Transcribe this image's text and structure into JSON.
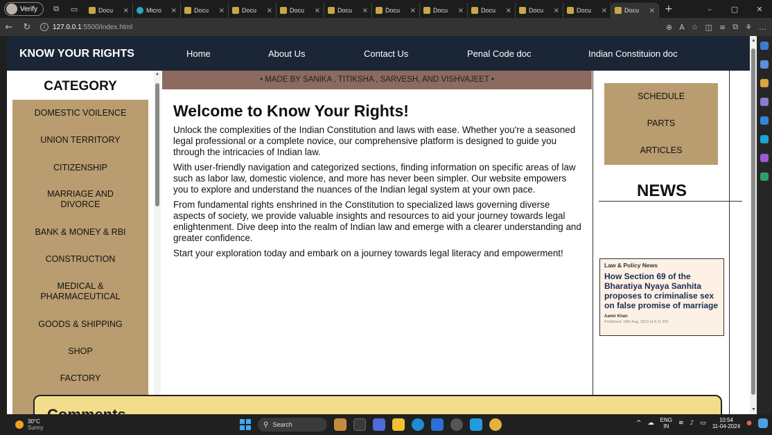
{
  "browser": {
    "profile_label": "Verify",
    "tabs": [
      {
        "label": "Docu"
      },
      {
        "label": "Micro"
      },
      {
        "label": "Docu"
      },
      {
        "label": "Docu"
      },
      {
        "label": "Docu"
      },
      {
        "label": "Docu"
      },
      {
        "label": "Docu"
      },
      {
        "label": "Docu"
      },
      {
        "label": "Docu"
      },
      {
        "label": "Docu"
      },
      {
        "label": "Docu"
      },
      {
        "label": "Docu"
      }
    ],
    "url_host": "127.0.0.1",
    "url_path": ":5500/index.html"
  },
  "nav": {
    "brand": "KNOW YOUR RIGHTS",
    "links": [
      "Home",
      "About Us",
      "Contact Us",
      "Penal Code doc",
      "Indian Constituion doc"
    ]
  },
  "sidebar": {
    "title": "CATEGORY",
    "items": [
      "DOMESTIC VOILENCE",
      "UNION TERRITORY",
      "CITIZENSHIP",
      "MARRIAGE AND DIVORCE",
      "BANK & MONEY & RBI",
      "CONSTRUCTION",
      "MEDICAL & PHARMACEUTICAL",
      "GOODS & SHIPPING",
      "SHOP",
      "FACTORY"
    ]
  },
  "marquee": "• MADE BY SANIKA , TITIKSHA , SARVESH, AND VISHVAJEET •",
  "main": {
    "heading": "Welcome to Know Your Rights!",
    "paragraphs": [
      "Unlock the complexities of the Indian Constitution and laws with ease. Whether you're a seasoned legal professional or a complete novice, our comprehensive platform is designed to guide you through the intricacies of Indian law.",
      "With user-friendly navigation and categorized sections, finding information on specific areas of law such as labor law, domestic violence, and more has never been simpler. Our website empowers you to explore and understand the nuances of the Indian legal system at your own pace.",
      "From fundamental rights enshrined in the Constitution to specialized laws governing diverse aspects of society, we provide valuable insights and resources to aid your journey towards legal enlightenment. Dive deep into the realm of Indian law and emerge with a clearer understanding and greater confidence.",
      "Start your exploration today and embark on a journey towards legal literacy and empowerment!"
    ]
  },
  "right": {
    "links": [
      "SCHEDULE",
      "PARTS",
      "ARTICLES"
    ],
    "news_title": "NEWS",
    "news_card": {
      "category": "Law & Policy News",
      "headline": "How Section 69 of the Bharatiya Nyaya Sanhita proposes to criminalise sex on false promise of marriage",
      "author": "Aamir Khan",
      "published": "Published: 18th Aug, 2023 at 5:11 PM"
    }
  },
  "comments": {
    "title": "Comments"
  },
  "taskbar": {
    "temperature": "30°C",
    "weather": "Sunny",
    "search_placeholder": "Search",
    "lang_top": "ENG",
    "lang_bottom": "IN",
    "time": "10:54",
    "date": "11-04-2024"
  },
  "colors": {
    "nav_bg": "#1a2536",
    "category_bg": "#b99c6f",
    "marquee_bg": "#8c6a5e",
    "comments_bg": "#f3dd8d",
    "news_card_bg": "#fdf1e6"
  }
}
